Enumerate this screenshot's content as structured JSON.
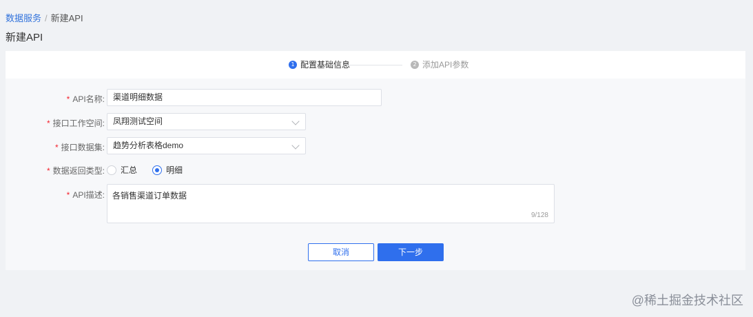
{
  "breadcrumb": {
    "parent": "数据服务",
    "separator": "/",
    "current": "新建API"
  },
  "page_title": "新建API",
  "steps": [
    {
      "num": "1",
      "label": "配置基础信息"
    },
    {
      "num": "2",
      "label": "添加API参数"
    }
  ],
  "form": {
    "required_mark": "*",
    "api_name": {
      "label": "API名称:",
      "value": "渠道明细数据"
    },
    "workspace": {
      "label": "接口工作空间:",
      "value": "凤翔测试空间"
    },
    "dataset": {
      "label": "接口数据集:",
      "value": "趋势分析表格demo"
    },
    "return_type": {
      "label": "数据返回类型:",
      "options": [
        "汇总",
        "明细"
      ],
      "selected": "明细"
    },
    "description": {
      "label": "API描述:",
      "value": "各销售渠道订单数据",
      "count": "9/128"
    }
  },
  "buttons": {
    "cancel": "取消",
    "next": "下一步"
  },
  "watermark": "@稀土掘金技术社区",
  "colors": {
    "primary": "#2f6fed",
    "required": "#f5222d",
    "background": "#f0f2f5"
  }
}
